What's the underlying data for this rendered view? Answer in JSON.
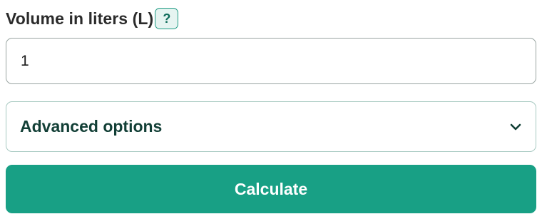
{
  "volume": {
    "label": "Volume in liters (L)",
    "help_label": "?",
    "value": "1"
  },
  "advanced": {
    "label": "Advanced options",
    "icon": "chevron-down-icon"
  },
  "actions": {
    "calculate_label": "Calculate"
  },
  "colors": {
    "accent": "#18a085",
    "label_text": "#2b2b2b",
    "advanced_text": "#123f36"
  }
}
